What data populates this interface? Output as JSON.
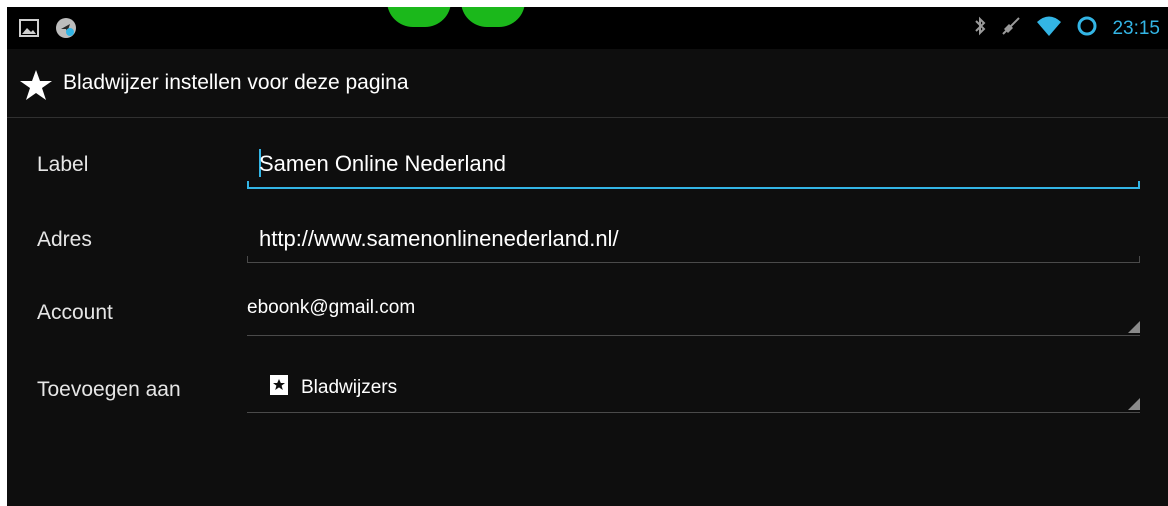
{
  "status_bar": {
    "left_icons": [
      "gallery-icon",
      "app-notification-icon"
    ],
    "right_icons": [
      "bluetooth-icon",
      "mute-icon",
      "wifi-icon",
      "sync-icon"
    ],
    "time": "23:15"
  },
  "dialog": {
    "title": "Bladwijzer instellen voor deze pagina",
    "title_icon": "star-icon",
    "fields": {
      "label": {
        "label": "Label",
        "value": "Samen Online Nederland"
      },
      "address": {
        "label": "Adres",
        "value": "http://www.samenonlinenederland.nl/"
      },
      "account": {
        "label": "Account",
        "value": "eboonk@gmail.com"
      },
      "add_to": {
        "label": "Toevoegen aan",
        "value": "Bladwijzers",
        "icon": "bookmark-folder-icon"
      }
    }
  },
  "colors": {
    "accent": "#33b5e5",
    "background": "#0e0e0e",
    "logo": "#1bb81b"
  }
}
